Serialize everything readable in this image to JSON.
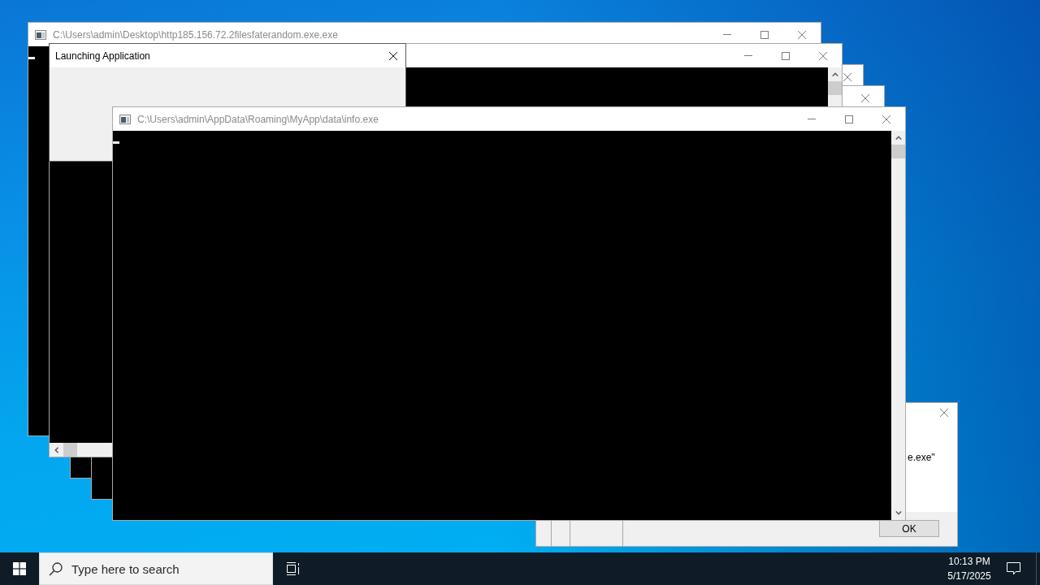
{
  "windows": [
    {
      "kind": "console",
      "title": "C:\\Users\\admin\\Desktop\\http185.156.72.2filesfaterandom.exe.exe",
      "active": false,
      "horizontal_scrollbar": false
    },
    {
      "kind": "console",
      "active": false,
      "horizontal_scrollbar": true
    },
    {
      "kind": "dialog",
      "title": "Launching Application",
      "active": true
    },
    {
      "kind": "console",
      "active": false,
      "horizontal_scrollbar": false
    },
    {
      "kind": "console",
      "active": false,
      "horizontal_scrollbar": false
    },
    {
      "kind": "console",
      "title": "C:\\Users\\admin\\AppData\\Roaming\\MyApp\\data\\info.exe",
      "active": false,
      "horizontal_scrollbar": false
    },
    {
      "kind": "message",
      "text": "e.exe\"",
      "button": "OK",
      "active": false
    }
  ],
  "taskbar": {
    "search": {
      "placeholder": "Type here to search"
    },
    "clock": {
      "time": "10:13 PM",
      "date": "5/17/2025"
    }
  }
}
